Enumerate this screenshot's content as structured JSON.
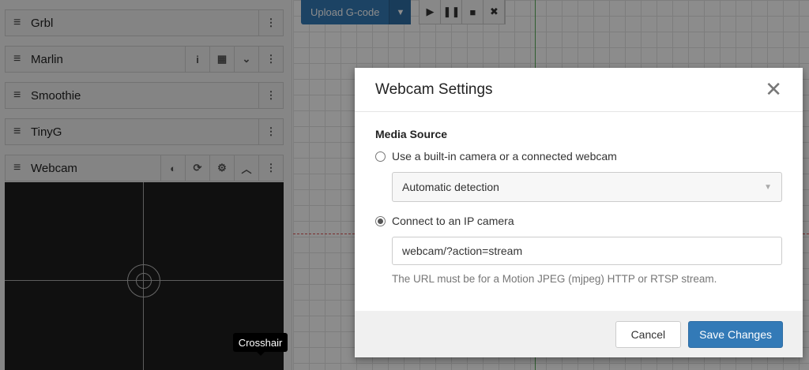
{
  "sidebar": {
    "panels": [
      {
        "title": "Grbl"
      },
      {
        "title": "Marlin"
      },
      {
        "title": "Smoothie"
      },
      {
        "title": "TinyG"
      },
      {
        "title": "Webcam"
      }
    ]
  },
  "tooltip": "Crosshair",
  "toolbar": {
    "upload_label": "Upload G-code"
  },
  "modal": {
    "title": "Webcam Settings",
    "section_label": "Media Source",
    "option_builtin": "Use a built-in camera or a connected webcam",
    "device_select": "Automatic detection",
    "option_ip": "Connect to an IP camera",
    "selected_option": "ip",
    "url_value": "webcam/?action=stream",
    "help_text": "The URL must be for a Motion JPEG (mjpeg) HTTP or RTSP stream.",
    "cancel_label": "Cancel",
    "save_label": "Save Changes"
  },
  "colors": {
    "primary": "#337ab7"
  }
}
